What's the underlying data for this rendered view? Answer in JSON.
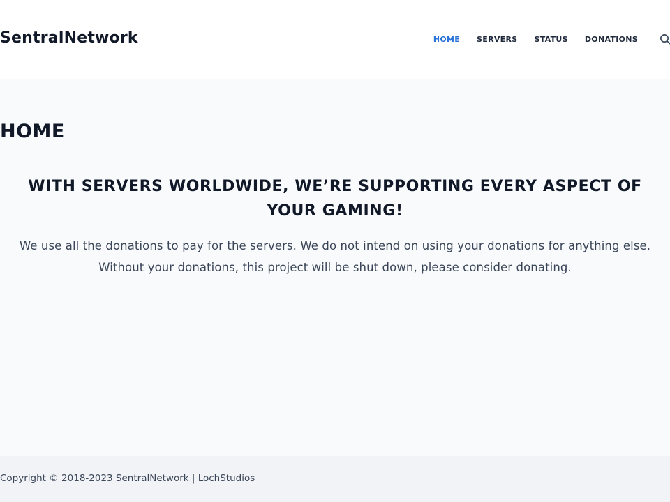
{
  "header": {
    "site_title": "SentralNetwork",
    "nav": [
      {
        "label": "HOME",
        "active": true
      },
      {
        "label": "SERVERS",
        "active": false
      },
      {
        "label": "STATUS",
        "active": false
      },
      {
        "label": "DONATIONS",
        "active": false
      }
    ],
    "search_icon": "search-icon"
  },
  "main": {
    "page_title": "HOME",
    "headline": "WITH SERVERS WORLDWIDE, WE’RE SUPPORTING EVERY ASPECT OF YOUR GAMING!",
    "lead": "We use all the donations to pay for the servers. We do not intend on using your donations for anything else. Without your donations, this project will be shut down, please consider donating."
  },
  "footer": {
    "copyright": "Copyright © 2018-2023 SentralNetwork | LochStudios"
  },
  "colors": {
    "accent": "#2872d9",
    "text_dark": "#111827",
    "body_bg": "#f8fafc",
    "header_bg": "#ffffff",
    "footer_bg": "#f1f3f6"
  }
}
